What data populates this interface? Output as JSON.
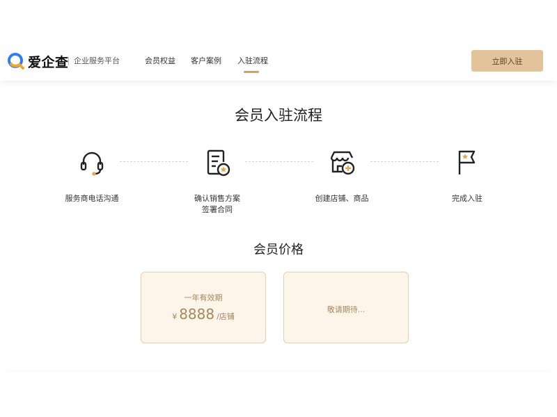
{
  "colors": {
    "accent": "#c9a46e",
    "button_bg": "#e3c49a",
    "card_bg": "#fdf5ea",
    "card_border": "#e5cfae",
    "price_text": "#a88759",
    "logo_blue": "#2c7ef8",
    "logo_orange": "#f5a623"
  },
  "header": {
    "logo_text": "爱企查",
    "logo_subtitle": "企业服务平台",
    "nav": [
      {
        "label": "会员权益"
      },
      {
        "label": "客户案例"
      },
      {
        "label": "入驻流程",
        "active": true
      }
    ],
    "cta_label": "立即入驻"
  },
  "process": {
    "title": "会员入驻流程",
    "steps": [
      {
        "icon": "headset-icon",
        "label": "服务商电话沟通"
      },
      {
        "icon": "contract-icon",
        "label_line1": "确认销售方案",
        "label_line2": "签署合同"
      },
      {
        "icon": "store-add-icon",
        "label": "创建店铺、商品"
      },
      {
        "icon": "flag-icon",
        "label": "完成入驻"
      }
    ]
  },
  "pricing": {
    "title": "会员价格",
    "cards": [
      {
        "period": "一年有效期",
        "currency": "¥",
        "price": "8888",
        "unit": "/店铺"
      },
      {
        "coming_soon": "敬请期待..."
      }
    ]
  }
}
